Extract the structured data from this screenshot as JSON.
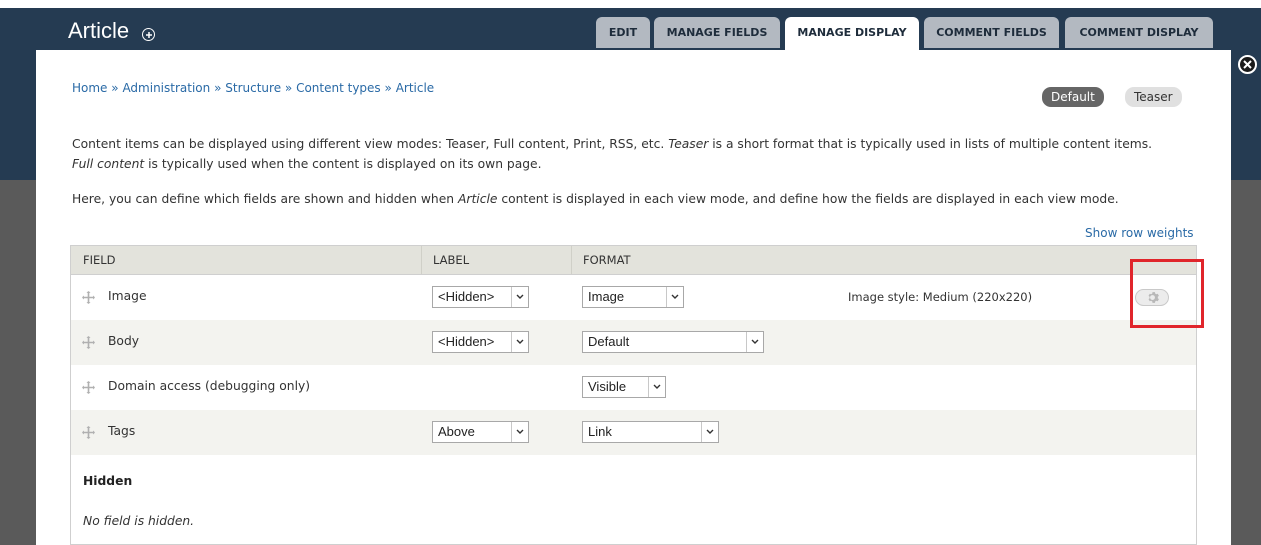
{
  "header": {
    "title": "Article",
    "tabs": [
      {
        "label": "EDIT",
        "active": false
      },
      {
        "label": "MANAGE FIELDS",
        "active": false
      },
      {
        "label": "MANAGE DISPLAY",
        "active": true
      },
      {
        "label": "COMMENT FIELDS",
        "active": false
      },
      {
        "label": "COMMENT DISPLAY",
        "active": false
      }
    ]
  },
  "breadcrumb": {
    "items": [
      "Home",
      "Administration",
      "Structure",
      "Content types",
      "Article"
    ],
    "separator": "»"
  },
  "view_modes": {
    "default_label": "Default",
    "teaser_label": "Teaser"
  },
  "description": {
    "p1_a": "Content items can be displayed using different view modes: Teaser, Full content, Print, RSS, etc. ",
    "p1_teaser": "Teaser",
    "p1_b": " is a short format that is typically used in lists of multiple content items.",
    "p1_full": "Full content",
    "p1_c": " is typically used when the content is displayed on its own page.",
    "p2_a": "Here, you can define which fields are shown and hidden when ",
    "p2_article": "Article",
    "p2_b": " content is displayed in each view mode, and define how the fields are displayed in each view mode."
  },
  "row_weights_link": "Show row weights",
  "table": {
    "headers": {
      "field": "FIELD",
      "label": "LABEL",
      "format": "FORMAT"
    },
    "rows": [
      {
        "field": "Image",
        "label": "<Hidden>",
        "format": "Image",
        "summary": "Image style: Medium (220x220)"
      },
      {
        "field": "Body",
        "label": "<Hidden>",
        "format": "Default",
        "summary": ""
      },
      {
        "field": "Domain access (debugging only)",
        "label": "",
        "format": "Visible",
        "summary": ""
      },
      {
        "field": "Tags",
        "label": "Above",
        "format": "Link",
        "summary": ""
      }
    ],
    "hidden_heading": "Hidden",
    "hidden_message": "No field is hidden."
  },
  "icons": {
    "add": "plus-circle-icon",
    "close": "close-icon",
    "drag": "drag-handle-icon",
    "gear": "gear-icon",
    "dropdown": "chevron-down-icon"
  },
  "colors": {
    "header_bg": "#253b52",
    "link": "#2a6aa6",
    "highlight": "#e0252b",
    "active_mode": "#666666"
  }
}
